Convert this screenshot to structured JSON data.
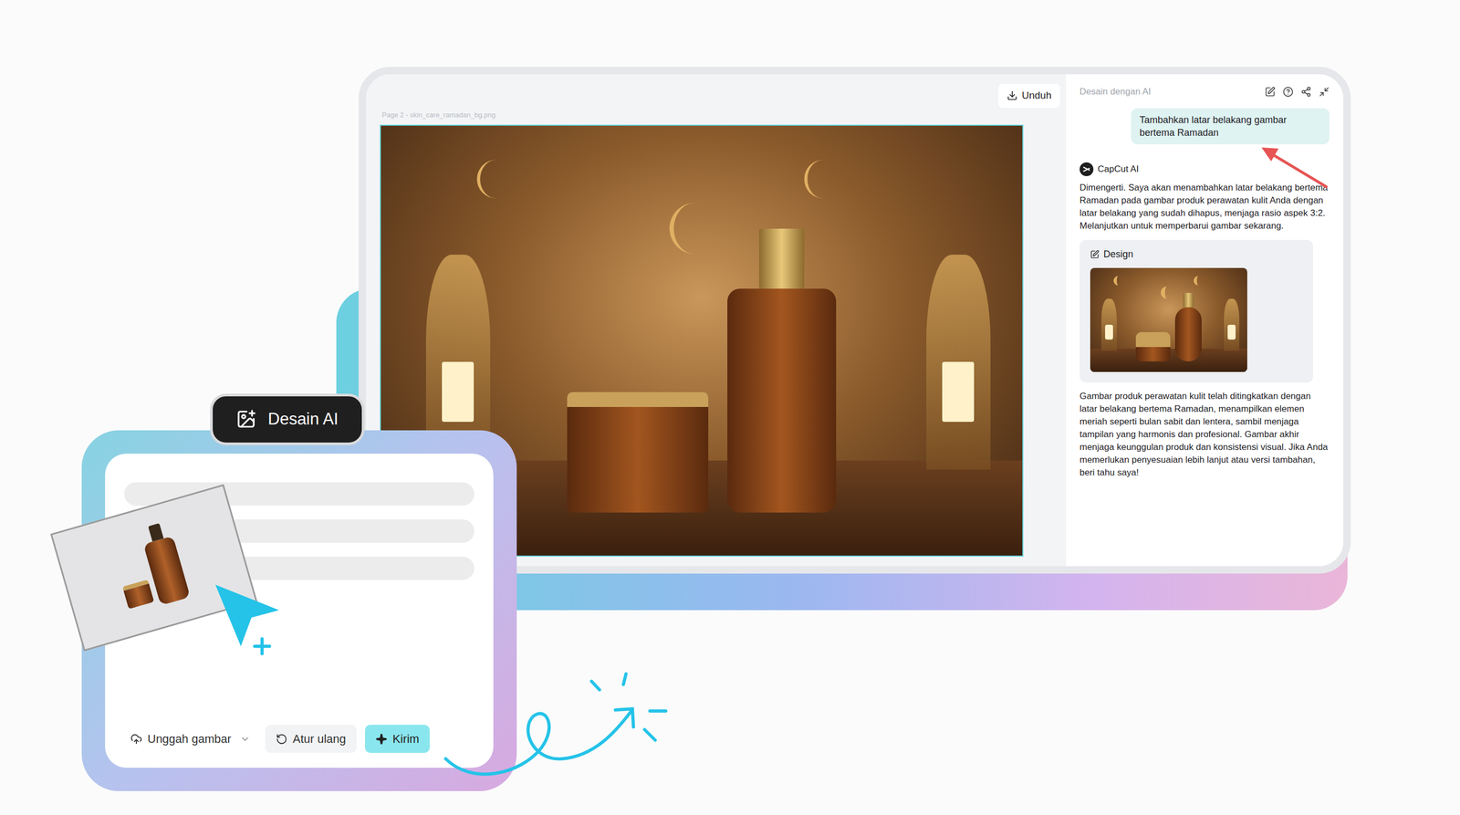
{
  "canvas": {
    "page_label": "Page 2 - skin_care_ramadan_bg.png",
    "download_button": "Unduh"
  },
  "chat_panel": {
    "title": "Desain dengan AI",
    "user_message": "Tambahkan latar belakang gambar bertema Ramadan",
    "assistant_name": "CapCut AI",
    "assistant_intro": "Dimengerti. Saya akan menambahkan latar belakang bertema Ramadan pada gambar produk perawatan kulit Anda dengan latar belakang yang sudah dihapus, menjaga rasio aspek 3:2. Melanjutkan untuk memperbarui gambar sekarang.",
    "design_card": {
      "label": "Design"
    },
    "assistant_summary": "Gambar produk perawatan kulit telah ditingkatkan dengan latar belakang bertema Ramadan, menampilkan elemen meriah seperti bulan sabit dan lentera, sambil menjaga tampilan yang harmonis dan profesional. Gambar akhir menjaga keunggulan produk dan konsistensi visual. Jika Anda memerlukan penyesuaian lebih lanjut atau versi tambahan, beri tahu saya!"
  },
  "prompt_card": {
    "badge": "Desain AI",
    "buttons": [
      {
        "label": "Unggah gambar",
        "kind": "dropdown"
      },
      {
        "label": "Atur ulang",
        "kind": "reset"
      },
      {
        "label": "Kirim",
        "kind": "primary"
      }
    ]
  }
}
